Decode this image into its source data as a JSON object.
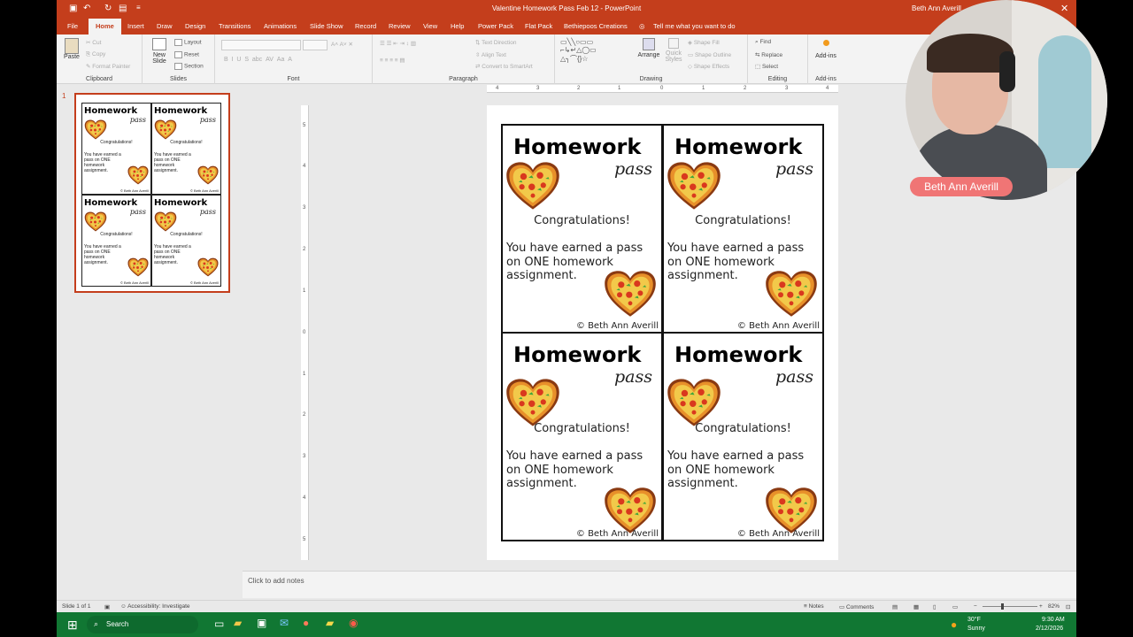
{
  "window": {
    "title": "Valentine Homework Pass Feb 12  -  PowerPoint",
    "user": "Beth Ann Averill"
  },
  "tabs": [
    "File",
    "Home",
    "Insert",
    "Draw",
    "Design",
    "Transitions",
    "Animations",
    "Slide Show",
    "Record",
    "Review",
    "View",
    "Help",
    "Power Pack",
    "Flat Pack",
    "Bethiepoos Creations"
  ],
  "active_tab": "Home",
  "tell_me": "Tell me what you want to do",
  "ribbon": {
    "clipboard": {
      "label": "Clipboard",
      "paste": "Paste",
      "cut": "Cut",
      "copy": "Copy",
      "format_painter": "Format Painter"
    },
    "slides": {
      "label": "Slides",
      "new_slide": "New Slide",
      "layout": "Layout",
      "reset": "Reset",
      "section": "Section"
    },
    "font": {
      "label": "Font"
    },
    "paragraph": {
      "label": "Paragraph",
      "text_direction": "Text Direction",
      "align_text": "Align Text",
      "convert_smartart": "Convert to SmartArt"
    },
    "drawing": {
      "label": "Drawing",
      "arrange": "Arrange",
      "quick_styles": "Quick Styles",
      "shape_fill": "Shape Fill",
      "shape_outline": "Shape Outline",
      "shape_effects": "Shape Effects"
    },
    "editing": {
      "label": "Editing",
      "find": "Find",
      "replace": "Replace",
      "select": "Select"
    },
    "addins": {
      "label": "Add-ins",
      "addins": "Add-ins"
    }
  },
  "thumbnail": {
    "number": "1"
  },
  "ruler": {
    "h_ticks": [
      "4",
      "3",
      "2",
      "1",
      "0",
      "1",
      "2",
      "3",
      "4"
    ],
    "v_ticks": [
      "5",
      "4",
      "3",
      "2",
      "1",
      "0",
      "1",
      "2",
      "3",
      "4",
      "5"
    ]
  },
  "slide": {
    "cards": [
      {
        "title": "Homework",
        "subtitle": "pass",
        "congrats": "Congratulations!",
        "earned": "You have earned a pass on ONE homework assignment.",
        "copyright": "© Beth Ann Averill"
      },
      {
        "title": "Homework",
        "subtitle": "pass",
        "congrats": "Congratulations!",
        "earned": "You have earned a pass on ONE homework assignment.",
        "copyright": "© Beth Ann Averill"
      },
      {
        "title": "Homework",
        "subtitle": "pass",
        "congrats": "Congratulations!",
        "earned": "You have earned a pass on ONE homework assignment.",
        "copyright": "© Beth Ann Averill"
      },
      {
        "title": "Homework",
        "subtitle": "pass",
        "congrats": "Congratulations!",
        "earned": "You have earned a pass on ONE homework assignment.",
        "copyright": "© Beth Ann Averill"
      }
    ]
  },
  "notes": {
    "placeholder": "Click to add notes"
  },
  "statusbar": {
    "slide_of": "Slide 1 of 1",
    "accessibility": "Accessibility: Investigate",
    "notes": "Notes",
    "comments": "Comments",
    "zoom": "82%"
  },
  "taskbar": {
    "search": "Search",
    "weather_temp": "30°F",
    "weather_desc": "Sunny",
    "time": "9:30 AM",
    "date": "2/12/2026"
  },
  "webcam": {
    "name": "Beth Ann Averill"
  },
  "colors": {
    "accent": "#c43e1c",
    "taskbar": "#117733",
    "heart_crust": "#e07a22",
    "sauce": "#d9381e"
  }
}
